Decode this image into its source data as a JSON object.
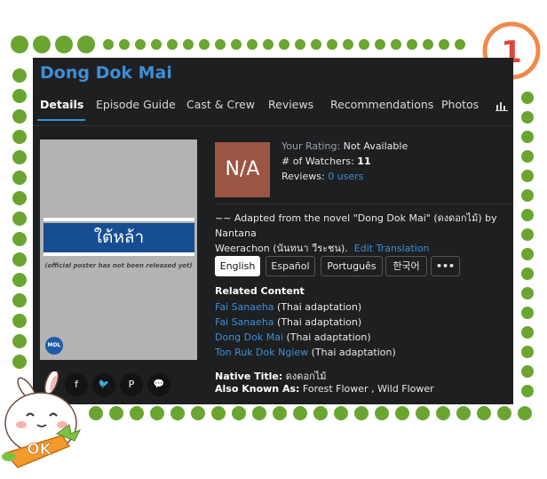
{
  "badge": {
    "number": "1"
  },
  "sticker": {
    "text": "OK"
  },
  "show": {
    "title": "Dong Dok Mai"
  },
  "tabs": [
    {
      "label": "Details"
    },
    {
      "label": "Episode Guide"
    },
    {
      "label": "Cast & Crew"
    },
    {
      "label": "Reviews"
    },
    {
      "label": "Recommendations"
    },
    {
      "label": "Photos"
    }
  ],
  "poster": {
    "band_text": "ใต้หล้า",
    "note": "(official poster has not been released yet)",
    "logo": "MDL"
  },
  "social": {
    "facebook": "f",
    "twitter": "🐦",
    "pinterest": "P",
    "comments": "💬"
  },
  "rating": {
    "score_box": "N/A",
    "your_rating_label": "Your Rating:",
    "your_rating_value": "Not Available",
    "watchers_label": "# of Watchers:",
    "watchers_value": "11",
    "reviews_label": "Reviews:",
    "reviews_value": "0 users"
  },
  "description": {
    "line1": "~~ Adapted from the novel \"Dong Dok Mai\" (ดงดอกไม้) by Nantana",
    "line2": "Weerachon (นันทนา วีระชน).",
    "edit_link": "Edit Translation"
  },
  "languages": [
    {
      "label": "English"
    },
    {
      "label": "Español"
    },
    {
      "label": "Português"
    },
    {
      "label": "한국어"
    },
    {
      "label": "•••"
    }
  ],
  "related": {
    "heading": "Related Content",
    "items": [
      {
        "title": "Fai Sanaeha",
        "note": "(Thai adaptation)"
      },
      {
        "title": "Fai Sanaeha",
        "note": "(Thai adaptation)"
      },
      {
        "title": "Dong Dok Mai",
        "note": "(Thai adaptation)"
      },
      {
        "title": "Ton Ruk Dok Ngiew",
        "note": "(Thai adaptation)"
      }
    ]
  },
  "native_title": {
    "label": "Native Title:",
    "value": "ดงดอกไม้"
  },
  "aka": {
    "label": "Also Known As:",
    "value": "Forest Flower , Wild Flower"
  },
  "colors": {
    "panel": "#1e1f21",
    "accent": "#3d8fd6",
    "dots": "#6aa532",
    "badge_ring": "#f08a4b",
    "badge_number": "#e1453a",
    "na_box": "#9c5543",
    "poster_band": "#174e92"
  }
}
